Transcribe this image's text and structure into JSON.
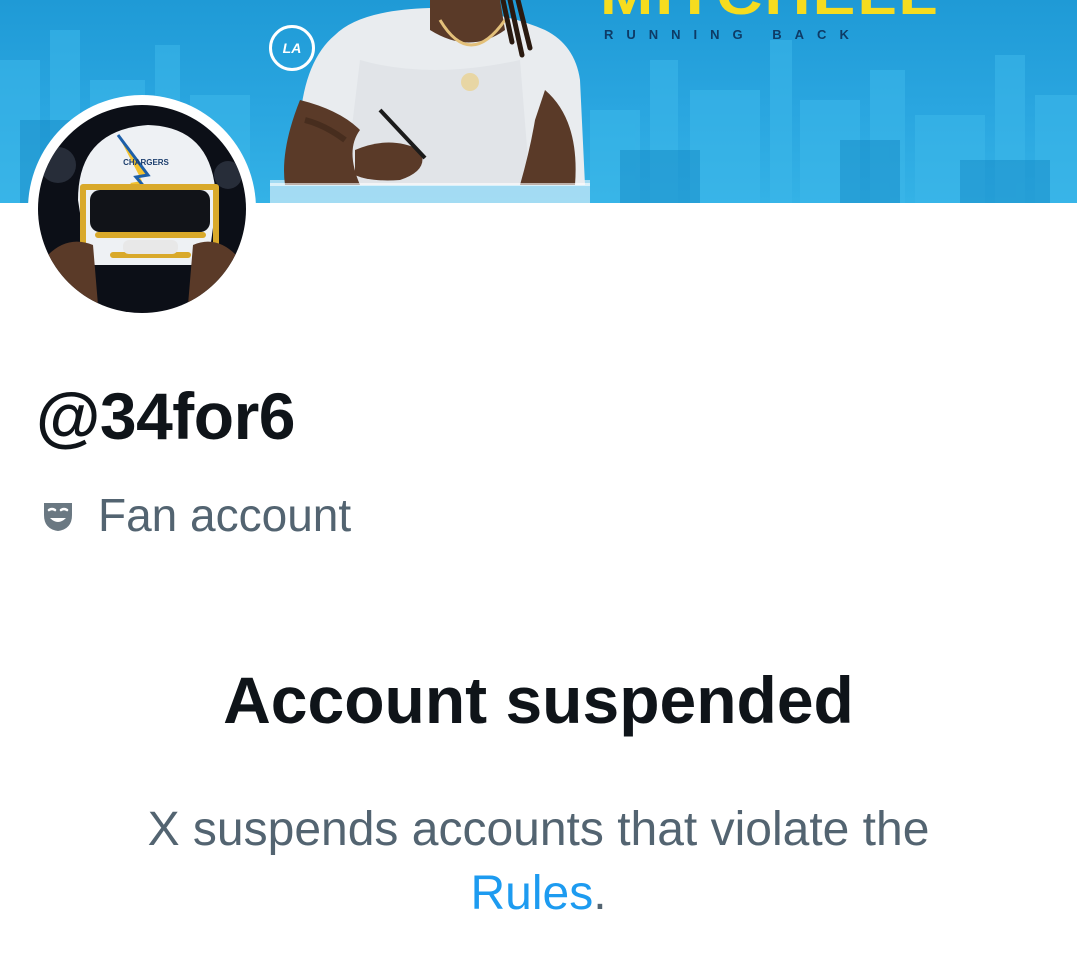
{
  "banner": {
    "title": "MITCHELL",
    "subtitle": "RUNNING BACK",
    "team_badge": "LA",
    "accent_color": "#2aa6e0",
    "title_color": "#f6dc1f"
  },
  "avatar": {
    "helmet_text": "CHARGERS"
  },
  "profile": {
    "handle": "@34for6",
    "label_icon": "theater-masks-icon",
    "label": "Fan account"
  },
  "notice": {
    "title": "Account suspended",
    "body_line1": "X suspends accounts that violate the",
    "rules_link": "Rules",
    "period": ".",
    "link_color": "#1d9bf0"
  }
}
